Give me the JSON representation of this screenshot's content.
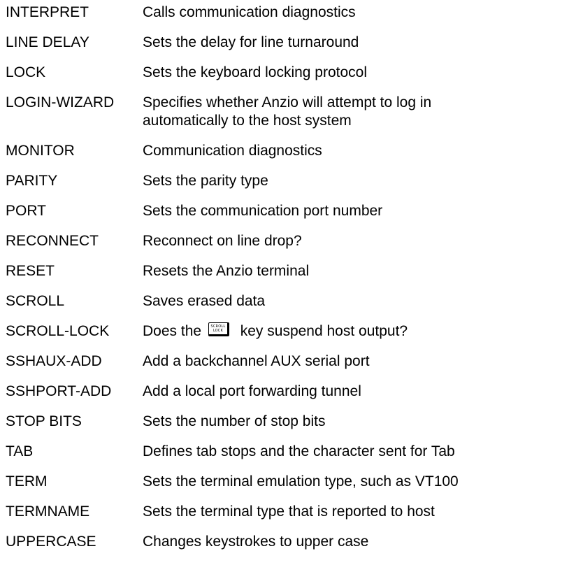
{
  "commands": [
    {
      "command": "INTERPRET",
      "description": "Calls communication diagnostics"
    },
    {
      "command": "LINE DELAY",
      "description": "Sets the delay for line turnaround"
    },
    {
      "command": "LOCK",
      "description": "Sets the keyboard locking protocol"
    },
    {
      "command": "LOGIN-WIZARD",
      "description_line1": "Specifies whether Anzio will attempt to log in",
      "description_line2": "automatically to the host system"
    },
    {
      "command": "MONITOR",
      "description": "Communication diagnostics"
    },
    {
      "command": "PARITY",
      "description": "Sets the parity type"
    },
    {
      "command": "PORT",
      "description": "Sets the communication port number"
    },
    {
      "command": "RECONNECT",
      "description": "Reconnect on line drop?"
    },
    {
      "command": "RESET",
      "description": "Resets the Anzio terminal"
    },
    {
      "command": "SCROLL",
      "description": "Saves erased data"
    },
    {
      "command": "SCROLL-LOCK",
      "description_before": "Does the",
      "key_top": "SCROLL",
      "key_bottom": "LOCK",
      "key_icon": "scroll-lock-key-icon",
      "description_after": "key suspend host output?"
    },
    {
      "command": "SSHAUX-ADD",
      "description": "Add a backchannel AUX serial port"
    },
    {
      "command": "SSHPORT-ADD",
      "description": "Add a local port forwarding tunnel"
    },
    {
      "command": "STOP BITS",
      "description": "Sets the number of stop bits"
    },
    {
      "command": "TAB",
      "description": "Defines tab stops and the character sent for Tab"
    },
    {
      "command": "TERM",
      "description": "Sets the terminal emulation type, such as VT100"
    },
    {
      "command": "TERMNAME",
      "description": "Sets the terminal type that is reported to host"
    },
    {
      "command": "UPPERCASE",
      "description": "Changes keystrokes to upper case"
    }
  ]
}
